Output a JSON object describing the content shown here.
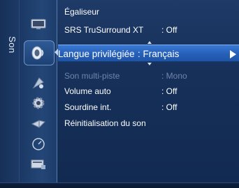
{
  "side_label": "Son",
  "icons": [
    {
      "name": "picture-icon"
    },
    {
      "name": "sound-icon",
      "selected": true
    },
    {
      "name": "channel-icon"
    },
    {
      "name": "setup-icon"
    },
    {
      "name": "input-icon"
    },
    {
      "name": "application-icon"
    },
    {
      "name": "support-icon"
    }
  ],
  "menu": {
    "items": [
      {
        "label": "Égaliseur",
        "value": ""
      },
      {
        "label": "SRS TruSurround XT",
        "value": ": Off"
      },
      {
        "label": "Langue privilégiée",
        "value": ": Français",
        "selected": true
      },
      {
        "label": "Son multi-piste",
        "value": ": Mono",
        "disabled": true
      },
      {
        "label": "Volume auto",
        "value": ": Off"
      },
      {
        "label": "Sourdine int.",
        "value": ": Off"
      },
      {
        "label": "Réinitialisation du son",
        "value": ""
      }
    ]
  },
  "colors": {
    "highlight": "#2b68c4",
    "background": "#16305a",
    "disabled_text": "#6f86ad"
  }
}
